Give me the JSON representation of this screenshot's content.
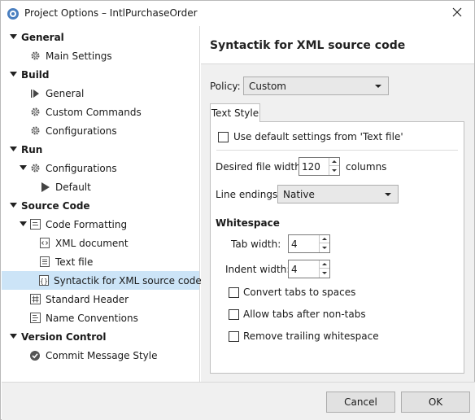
{
  "window": {
    "title": "Project Options – IntlPurchaseOrder"
  },
  "sidebar": {
    "items": [
      {
        "label": "General"
      },
      {
        "label": "Main Settings"
      },
      {
        "label": "Build"
      },
      {
        "label": "General"
      },
      {
        "label": "Custom Commands"
      },
      {
        "label": "Configurations"
      },
      {
        "label": "Run"
      },
      {
        "label": "Configurations"
      },
      {
        "label": "Default"
      },
      {
        "label": "Source Code"
      },
      {
        "label": "Code Formatting"
      },
      {
        "label": "XML document"
      },
      {
        "label": "Text file"
      },
      {
        "label": "Syntactik for XML source code"
      },
      {
        "label": "Standard Header"
      },
      {
        "label": "Name Conventions"
      },
      {
        "label": "Version Control"
      },
      {
        "label": "Commit Message Style"
      }
    ]
  },
  "main": {
    "title": "Syntactik for XML source code",
    "policy_label": "Policy:",
    "policy_value": "Custom",
    "tab_label": "Text Style",
    "use_default_label": "Use default settings from 'Text file'",
    "desired_width_label": "Desired file width:",
    "desired_width_value": "120",
    "columns_label": "columns",
    "line_endings_label": "Line endings:",
    "line_endings_value": "Native",
    "whitespace_heading": "Whitespace",
    "tab_width_label": "Tab width:",
    "tab_width_value": "4",
    "indent_width_label": "Indent width:",
    "indent_width_value": "4",
    "convert_tabs_label": "Convert tabs to spaces",
    "allow_tabs_label": "Allow tabs after non-tabs",
    "remove_trailing_label": "Remove trailing whitespace"
  },
  "footer": {
    "cancel_label": "Cancel",
    "ok_label": "OK"
  },
  "colors": {
    "selection": "#cce4f7",
    "panel_bg": "#f0f0f0"
  }
}
